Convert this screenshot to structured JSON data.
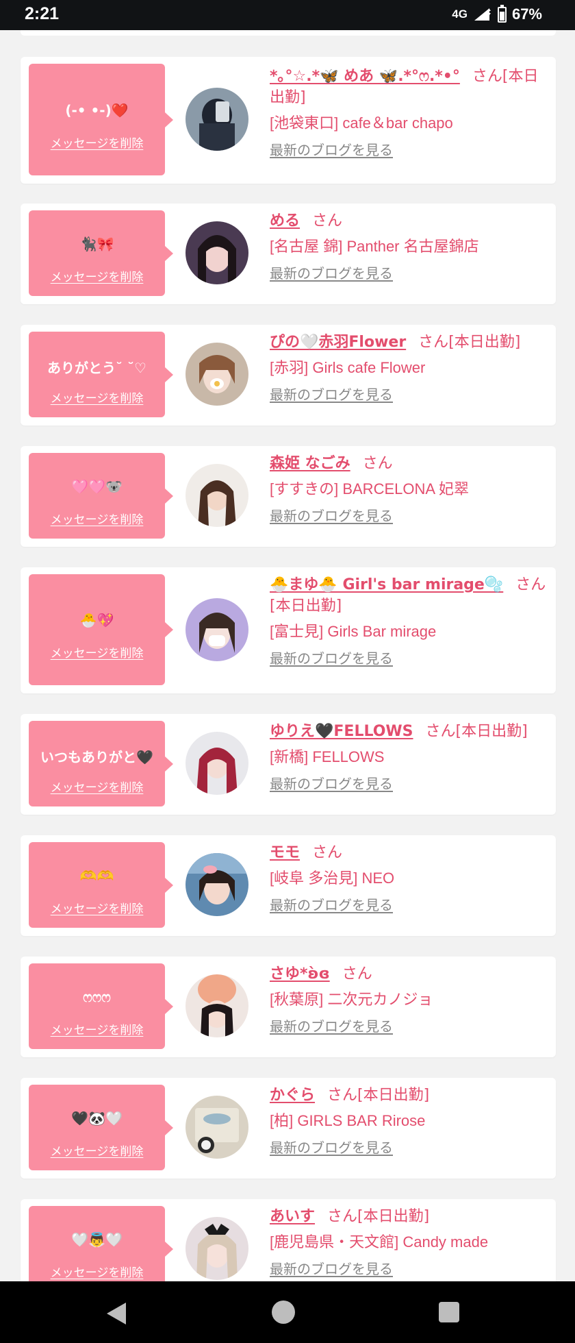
{
  "status": {
    "time": "2:21",
    "network": "4G",
    "battery": "67%",
    "battery_level": 0.67
  },
  "delete_label": "メッセージを削除",
  "blog_label": "最新のブログを見る",
  "san": "さん",
  "cards": [
    {
      "message": "(-• •-)❤️",
      "name": "*｡°☆.*🦋 めあ 🦋.*°ෆ.*•°",
      "suffix": "[本日出勤]",
      "shop": "[池袋東口] cafe＆bar chapo"
    },
    {
      "message": "🐈‍⬛🎀",
      "name": "める",
      "suffix": "",
      "shop": "[名古屋 錦] Panther 名古屋錦店"
    },
    {
      "message": "ありがとう˘ ˘♡",
      "name": "ぴの🤍赤羽Flower",
      "suffix": "[本日出勤]",
      "shop": "[赤羽] Girls cafe Flower"
    },
    {
      "message": "🩷🩷🐨",
      "name": "森姫 なごみ",
      "suffix": "",
      "shop": "[すすきの] BARCELONA 妃翠"
    },
    {
      "message": "🐣💖",
      "name": "🐣まゆ🐣 Girl's bar mirage🫧",
      "suffix": "[本日出勤]",
      "shop": "[富士見] Girls Bar mirage"
    },
    {
      "message": "いつもありがと🖤",
      "name": "ゆりえ🖤FELLOWS",
      "suffix": "[本日出勤]",
      "shop": "[新橋] FELLOWS"
    },
    {
      "message": "🫶🫶",
      "name": "モモ",
      "suffix": "",
      "shop": "[岐阜 多治見] NEO"
    },
    {
      "message": "ෆෆෆ",
      "name": "さゆ*ʚ̀ɞ",
      "suffix": "",
      "shop": "[秋葉原] 二次元カノジョ"
    },
    {
      "message": "🖤🐼🤍",
      "name": "かぐら",
      "suffix": "[本日出勤]",
      "shop": "[柏] GIRLS BAR Rirose"
    },
    {
      "message": "🤍👼🤍",
      "name": "あいす",
      "suffix": "[本日出勤]",
      "shop": "[鹿児島県・天文館] Candy made"
    }
  ],
  "avatar_icon": "profile-photo",
  "colors": {
    "accent": "#e34d6d",
    "bubble": "#fa8ea1",
    "background": "#f2f2f2",
    "blog_link": "#888888"
  }
}
